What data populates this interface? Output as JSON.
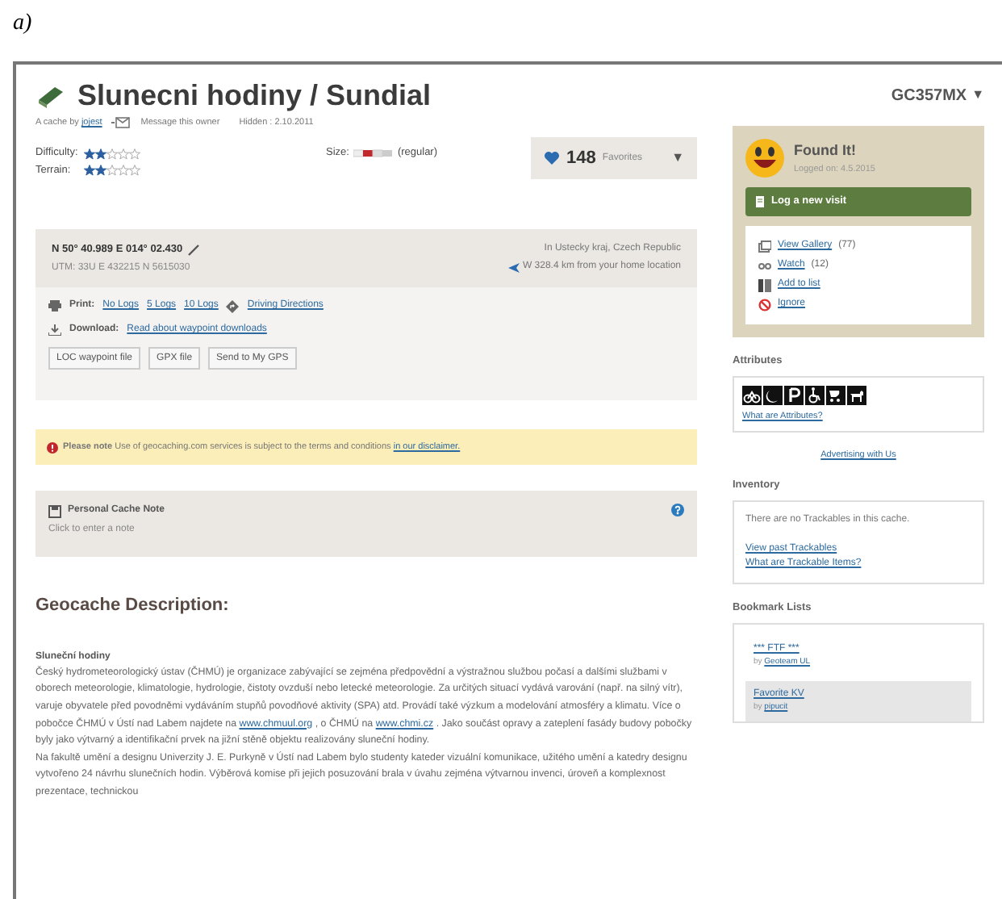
{
  "figure_label": "a)",
  "header": {
    "title": "Slunecni hodiny / Sundial",
    "cache_by": "A cache by",
    "owner": "jojest",
    "message": "Message this owner",
    "hidden": "Hidden : 2.10.2011",
    "code": "GC357MX",
    "code_caret": "▼"
  },
  "ratings": [
    {
      "label": "Difficulty:",
      "stars": 2
    },
    {
      "label": "Terrain:",
      "stars": 2
    }
  ],
  "size": {
    "label": "Size:",
    "value": "(regular)"
  },
  "favorites": {
    "count": "148",
    "label": "Favorites",
    "caret": "▼"
  },
  "location": {
    "coords": "N 50° 40.989 E 014° 02.430",
    "utm": "UTM: 33U E 432215 N 5615030",
    "region": "In Ustecky kraj, Czech Republic",
    "distance": "W 328.4 km from your home location"
  },
  "print": {
    "label": "Print:",
    "links": [
      "No Logs",
      "5 Logs",
      "10 Logs"
    ],
    "directions": "Driving Directions"
  },
  "download": {
    "label": "Download:",
    "link": "Read about waypoint downloads",
    "buttons": [
      "LOC waypoint file",
      "GPX file",
      "Send to My GPS"
    ]
  },
  "notice": {
    "text": "**Please note** Use of geocaching.com services is subject to the terms and conditions",
    "link": "in our disclaimer."
  },
  "personal_note": {
    "title": "Personal Cache Note",
    "placeholder": "Click to enter a note"
  },
  "description": {
    "heading": "Geocache Description:",
    "subheading": "Sluneční hodiny",
    "paragraphs": [
      [
        {
          "kind": "text",
          "text": "Český hydrometeorologický ústav (ČHMÚ) je organizace zabývající se zejména předpovědní a výstražnou službou počasí a dalšími službami v oborech meteorologie, klimatologie, hydrologie, čistoty ovzduší nebo letecké meteorologie. Za určitých situací vydává varování (např. na silný vítr), varuje obyvatele před povodněmi vydáváním stupňů povodňové aktivity (SPA) atd. Provádí také výzkum a modelování atmosféry a klimatu. Více o pobočce ČHMÚ v Ústí nad Labem najdete na "
        },
        {
          "kind": "link",
          "text": "www.chmuul.org"
        },
        {
          "kind": "text",
          "text": " , o ČHMÚ na "
        },
        {
          "kind": "link",
          "text": "www.chmi.cz"
        },
        {
          "kind": "text",
          "text": " . Jako součást opravy a zateplení fasády budovy pobočky byly jako výtvarný a identifikační prvek na jižní stěně objektu realizovány sluneční hodiny."
        }
      ],
      [
        {
          "kind": "text",
          "text": "Na fakultě umění a designu Univerzity J. E. Purkyně v Ústí nad Labem bylo studenty kateder vizuální komunikace, užitého umění a katedry designu vytvořeno 24 návrhu slunečních hodin. Výběrová komise při jejich posuzování brala v úvahu zejména výtvarnou invenci, úroveň a komplexnost prezentace, technickou"
        }
      ]
    ]
  },
  "sidebar": {
    "found": {
      "title": "Found It!",
      "logged": "Logged on: 4.5.2015",
      "log_button": "Log a new visit"
    },
    "actions": [
      {
        "kind": "gallery",
        "link": "View Gallery",
        "count": "(77)"
      },
      {
        "kind": "watch",
        "link": "Watch",
        "count": "(12)"
      },
      {
        "kind": "list",
        "link": "Add to list"
      },
      {
        "kind": "ignore",
        "link": "Ignore"
      }
    ],
    "attributes": {
      "heading": "Attributes",
      "icons": [
        {
          "kind": "bicycle"
        },
        {
          "kind": "moon"
        },
        {
          "kind": "parking"
        },
        {
          "kind": "wheelchair"
        },
        {
          "kind": "stroller"
        },
        {
          "kind": "dog"
        }
      ],
      "link": "What are Attributes?"
    },
    "advertising": "Advertising with Us",
    "inventory": {
      "heading": "Inventory",
      "text": "There are no Trackables in this cache.",
      "links": [
        "View past Trackables",
        "What are Trackable Items?"
      ]
    },
    "bookmarks": {
      "heading": "Bookmark Lists",
      "items": [
        {
          "name": "*** FTF ***",
          "by": "by",
          "owner": "Geoteam UL",
          "selected": false
        },
        {
          "name": "Favorite KV",
          "by": "by",
          "owner": "pipucit",
          "selected": true
        }
      ]
    }
  }
}
